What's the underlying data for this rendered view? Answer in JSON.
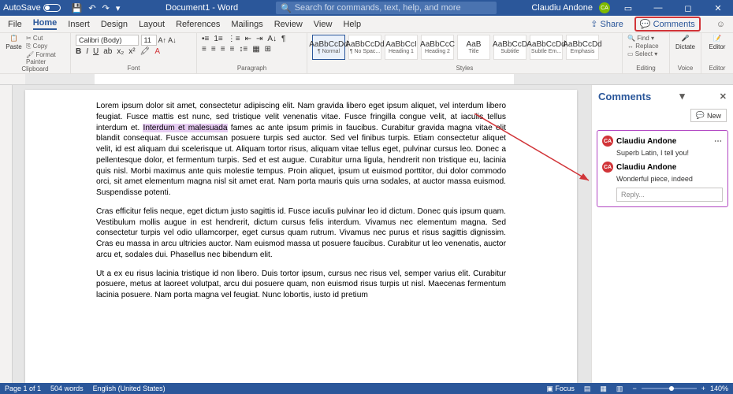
{
  "titlebar": {
    "autosave": "AutoSave",
    "doc_title": "Document1 - Word",
    "search_placeholder": "Search for commands, text, help, and more",
    "user": "Claudiu Andone",
    "user_initials": "CA"
  },
  "tabs": {
    "items": [
      "File",
      "Home",
      "Insert",
      "Design",
      "Layout",
      "References",
      "Mailings",
      "Review",
      "View",
      "Help"
    ],
    "share": "Share",
    "comments": "Comments"
  },
  "ribbon": {
    "clipboard": {
      "paste": "Paste",
      "cut": "Cut",
      "copy": "Copy",
      "painter": "Format Painter",
      "label": "Clipboard"
    },
    "font": {
      "name": "Calibri (Body)",
      "size": "11",
      "label": "Font"
    },
    "paragraph": {
      "label": "Paragraph"
    },
    "styles": {
      "items": [
        {
          "prev": "AaBbCcDd",
          "name": "¶ Normal",
          "sel": true
        },
        {
          "prev": "AaBbCcDd",
          "name": "¶ No Spac..."
        },
        {
          "prev": "AaBbCcI",
          "name": "Heading 1"
        },
        {
          "prev": "AaBbCcC",
          "name": "Heading 2"
        },
        {
          "prev": "AaB",
          "name": "Title"
        },
        {
          "prev": "AaBbCcD",
          "name": "Subtitle"
        },
        {
          "prev": "AaBbCcDd",
          "name": "Subtle Em..."
        },
        {
          "prev": "AaBbCcDd",
          "name": "Emphasis"
        }
      ],
      "label": "Styles"
    },
    "editing": {
      "find": "Find",
      "replace": "Replace",
      "select": "Select",
      "label": "Editing"
    },
    "voice": {
      "dictate": "Dictate",
      "label": "Voice"
    },
    "editor": {
      "editor": "Editor",
      "label": "Editor"
    }
  },
  "document": {
    "para1": "Lorem ipsum dolor sit amet, consectetur adipiscing elit. Nam gravida libero eget ipsum aliquet, vel interdum libero feugiat. Fusce mattis est nunc, sed tristique velit venenatis vitae. Fusce fringilla congue velit, at iaculis tellus interdum et. ",
    "highlight": "Interdum et malesuada",
    "para1b": " fames ac ante ipsum primis in faucibus. Curabitur gravida magna vitae elit blandit consequat. Fusce accumsan posuere turpis sed auctor. Sed vel finibus turpis. Etiam consectetur aliquet velit, id est aliquam dui scelerisque ut. Aliquam tortor risus, aliquam vitae tellus eget, pulvinar cursus leo. Donec a pellentesque dolor, et fermentum turpis. Sed et est augue. Curabitur urna ligula, hendrerit non tristique eu, lacinia quis nisl. Morbi maximus ante quis molestie tempus. Proin aliquet, ipsum ut euismod porttitor, dui dolor commodo orci, sit amet elementum magna nisl sit amet erat. Nam porta mauris quis urna sodales, at auctor massa euismod. Suspendisse potenti.",
    "para2": "Cras efficitur felis neque, eget dictum justo sagittis id. Fusce iaculis pulvinar leo id dictum. Donec quis ipsum quam. Vestibulum mollis augue in est hendrerit, dictum cursus felis interdum. Vivamus nec elementum magna. Sed consectetur turpis vel odio ullamcorper, eget cursus quam rutrum. Vivamus nec purus et risus sagittis dignissim. Cras eu massa in arcu ultricies auctor. Nam euismod massa ut posuere faucibus. Curabitur ut leo venenatis, auctor arcu et, sodales dui. Phasellus nec bibendum elit.",
    "para3": "Ut a ex eu risus lacinia tristique id non libero. Duis tortor ipsum, cursus nec risus vel, semper varius elit. Curabitur posuere, metus at laoreet volutpat, arcu dui posuere quam, non euismod risus turpis ut nisl. Maecenas fermentum lacinia posuere. Nam porta magna vel feugiat. Nunc lobortis, iusto id pretium"
  },
  "comments_pane": {
    "title": "Comments",
    "new": "New",
    "author1": "Claudiu Andone",
    "msg1": "Superb Latin, I tell you!",
    "author2": "Claudiu Andone",
    "msg2": "Wonderful piece, indeed",
    "reply": "Reply...",
    "initials": "CA"
  },
  "status": {
    "page": "Page 1 of 1",
    "words": "504 words",
    "lang": "English (United States)",
    "focus": "Focus",
    "zoom": "140%"
  }
}
